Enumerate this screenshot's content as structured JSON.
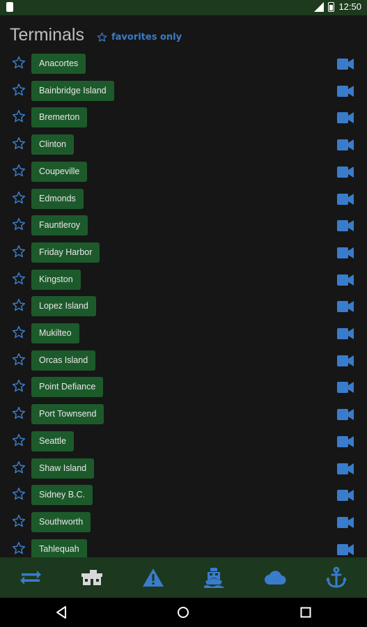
{
  "status_bar": {
    "time": "12:50",
    "network": "3G"
  },
  "header": {
    "title": "Terminals",
    "favorites_label": "favorites only"
  },
  "terminals": [
    {
      "name": "Anacortes"
    },
    {
      "name": "Bainbridge Island"
    },
    {
      "name": "Bremerton"
    },
    {
      "name": "Clinton"
    },
    {
      "name": "Coupeville"
    },
    {
      "name": "Edmonds"
    },
    {
      "name": "Fauntleroy"
    },
    {
      "name": "Friday Harbor"
    },
    {
      "name": "Kingston"
    },
    {
      "name": "Lopez Island"
    },
    {
      "name": "Mukilteo"
    },
    {
      "name": "Orcas Island"
    },
    {
      "name": "Point Defiance"
    },
    {
      "name": "Port Townsend"
    },
    {
      "name": "Seattle"
    },
    {
      "name": "Shaw Island"
    },
    {
      "name": "Sidney B.C."
    },
    {
      "name": "Southworth"
    },
    {
      "name": "Tahlequah"
    }
  ],
  "bottom_nav": [
    {
      "icon": "swap-arrows-icon"
    },
    {
      "icon": "terminal-building-icon"
    },
    {
      "icon": "alert-icon"
    },
    {
      "icon": "ferry-icon"
    },
    {
      "icon": "weather-cloud-icon"
    },
    {
      "icon": "anchor-icon"
    }
  ],
  "colors": {
    "background": "#161616",
    "status_bar": "#1d3a1f",
    "chip": "#1d5a2b",
    "accent_blue": "#3a7ccc",
    "bottom_nav": "#1c381e"
  }
}
